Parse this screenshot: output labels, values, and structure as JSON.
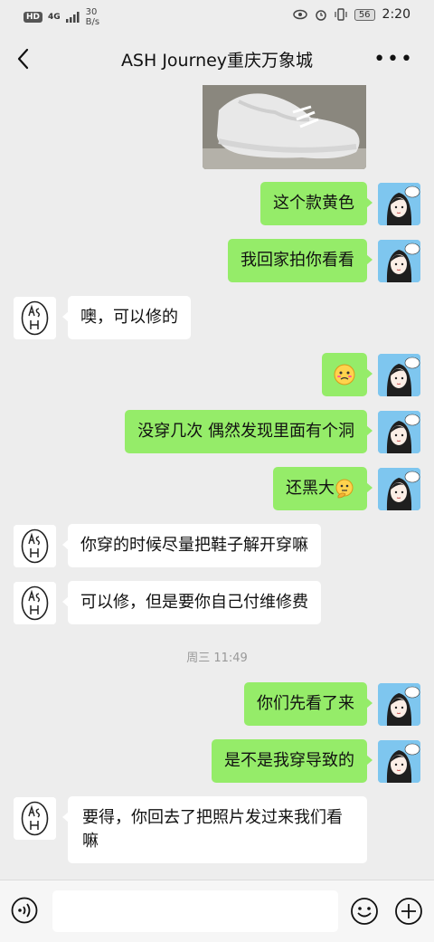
{
  "status_bar": {
    "hd": "HD",
    "network": "4G",
    "speed_value": "30",
    "speed_unit": "B/s",
    "battery": "56",
    "time": "2:20"
  },
  "header": {
    "title": "ASH Journey重庆万象城"
  },
  "messages": [
    {
      "from": "me",
      "text": "这个款黄色"
    },
    {
      "from": "me",
      "text": "我回家拍你看看"
    },
    {
      "from": "other",
      "text": "噢，可以修的"
    },
    {
      "from": "me",
      "text": "",
      "emoji": "embarrassed-emoji"
    },
    {
      "from": "me",
      "text": "没穿几次 偶然发现里面有个洞"
    },
    {
      "from": "me",
      "text": "还黑大",
      "emoji": "thinking-emoji"
    },
    {
      "from": "other",
      "text": "你穿的时候尽量把鞋子解开穿嘛"
    },
    {
      "from": "other",
      "text": "可以修，但是要你自己付维修费"
    },
    {
      "from": "me",
      "text": "你们先看了来"
    },
    {
      "from": "me",
      "text": "是不是我穿导致的"
    },
    {
      "from": "other",
      "text": "要得，你回去了把照片发过来我们看嘛"
    }
  ],
  "timestamp": "周三 11:49",
  "input": {
    "placeholder": ""
  },
  "icons": {
    "back": "chevron-left-icon",
    "more": "more-icon",
    "voice": "voice-icon",
    "emoji": "emoji-icon",
    "plus": "plus-icon"
  },
  "colors": {
    "my_bubble": "#95ec69",
    "other_bubble": "#ffffff",
    "background": "#ededed",
    "my_avatar_bg": "#7ec6ef"
  }
}
